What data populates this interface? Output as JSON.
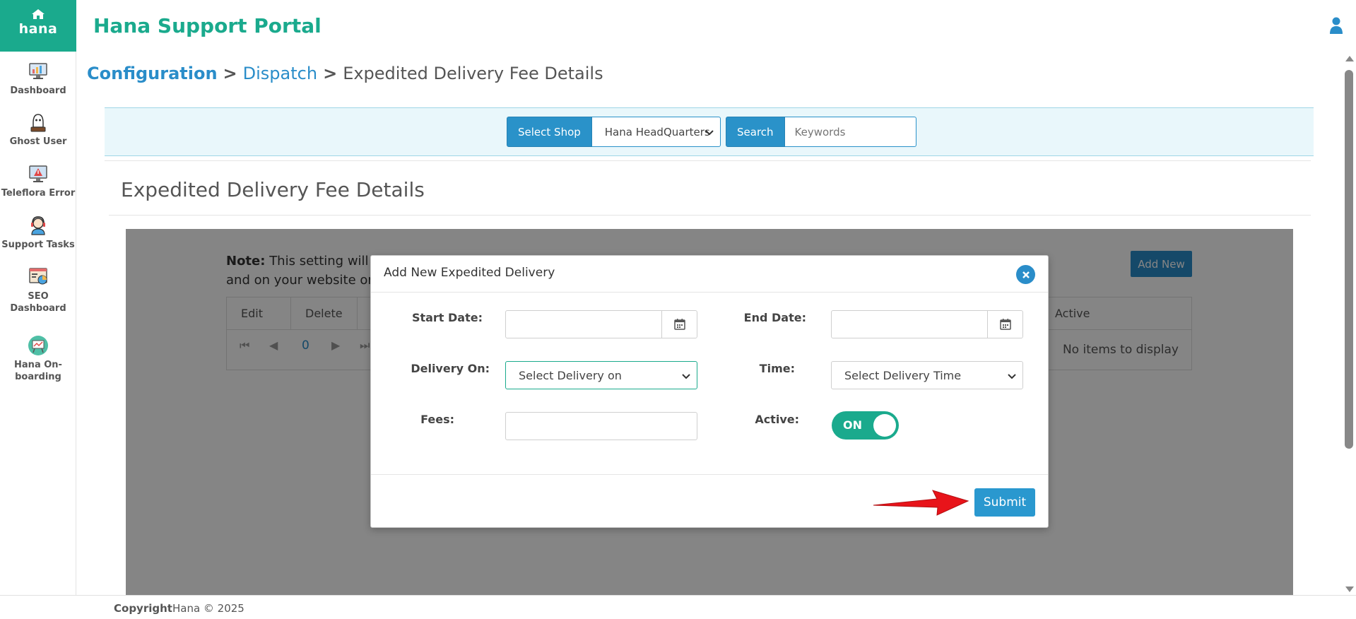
{
  "app": {
    "logo_text": "hana",
    "portal_title": "Hana Support Portal"
  },
  "sidebar": {
    "items": [
      {
        "label": "Dashboard",
        "icon": "dashboard-monitor-icon"
      },
      {
        "label": "Ghost User",
        "icon": "ghost-user-icon"
      },
      {
        "label": "Teleflora Error",
        "icon": "error-monitor-icon"
      },
      {
        "label": "Support Tasks",
        "icon": "support-agent-icon"
      },
      {
        "label": "SEO Dashboard",
        "icon": "seo-dashboard-icon"
      },
      {
        "label": "Hana On-boarding",
        "icon": "onboarding-board-icon"
      }
    ]
  },
  "breadcrumb": {
    "items": [
      "Configuration",
      "Dispatch",
      "Expedited Delivery Fee Details"
    ],
    "separator": ">"
  },
  "filter": {
    "shop_label": "Select Shop",
    "shop_value": "Hana HeadQuarters",
    "search_label": "Search",
    "search_placeholder": "Keywords"
  },
  "section": {
    "title": "Expedited Delivery Fee Details"
  },
  "grid": {
    "note_label": "Note:",
    "note_line1": "This setting will no",
    "note_line2": "and on your website ord",
    "add_new": "Add New",
    "columns": [
      "Edit",
      "Delete",
      "Active"
    ],
    "page_number": "0",
    "empty_text": "No items to display"
  },
  "modal": {
    "title": "Add New Expedited Delivery",
    "start_date_label": "Start Date:",
    "start_date_value": "",
    "end_date_label": "End Date:",
    "end_date_value": "",
    "delivery_on_label": "Delivery On:",
    "delivery_on_value": "Select Delivery on",
    "time_label": "Time:",
    "time_value": "Select Delivery Time",
    "fees_label": "Fees:",
    "fees_value": "",
    "active_label": "Active:",
    "active_toggle_text": "ON",
    "active_state": true,
    "submit_label": "Submit"
  },
  "footer": {
    "copyright_label": "Copyright",
    "copyright_text": "Hana © 2025"
  },
  "colors": {
    "brand": "#1aaa8d",
    "link": "#2a8dc9",
    "button": "#2a98cf",
    "annotation_arrow": "#e8141a"
  }
}
